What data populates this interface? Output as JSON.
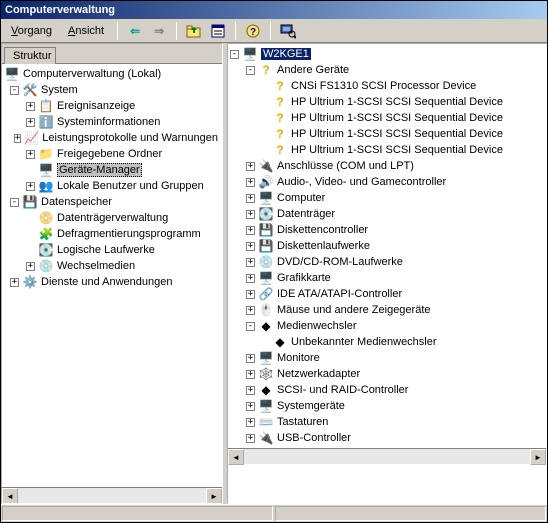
{
  "window": {
    "title": "Computerverwaltung"
  },
  "menu": {
    "vorgang": "Vorgang",
    "ansicht": "Ansicht"
  },
  "left": {
    "tab": "Struktur",
    "root": "Computerverwaltung (Lokal)",
    "system": "System",
    "ereignis": "Ereignisanzeige",
    "sysinfo": "Systeminformationen",
    "leistung": "Leistungsprotokolle und Warnungen",
    "freigeg": "Freigegebene Ordner",
    "geraete": "Geräte-Manager",
    "lokale": "Lokale Benutzer und Gruppen",
    "daten": "Datenspeicher",
    "dtverwalt": "Datenträgerverwaltung",
    "defrag": "Defragmentierungsprogramm",
    "logisch": "Logische Laufwerke",
    "wechsel": "Wechselmedien",
    "dienste": "Dienste und Anwendungen"
  },
  "right": {
    "root": "W2KGE1",
    "andere": "Andere Geräte",
    "dev0": "CNSi FS1310 SCSI Processor Device",
    "dev1": "HP Ultrium 1-SCSI SCSI Sequential Device",
    "dev2": "HP Ultrium 1-SCSI SCSI Sequential Device",
    "dev3": "HP Ultrium 1-SCSI SCSI Sequential Device",
    "dev4": "HP Ultrium 1-SCSI SCSI Sequential Device",
    "anschluesse": "Anschlüsse (COM und LPT)",
    "audio": "Audio-, Video- und Gamecontroller",
    "computer": "Computer",
    "datentraeger": "Datenträger",
    "diskctrl": "Diskettencontroller",
    "disklauf": "Diskettenlaufwerke",
    "dvd": "DVD/CD-ROM-Laufwerke",
    "grafik": "Grafikkarte",
    "ide": "IDE ATA/ATAPI-Controller",
    "maeuse": "Mäuse und andere Zeigegeräte",
    "medien": "Medienwechsler",
    "unbek": "Unbekannter Medienwechsler",
    "monitore": "Monitore",
    "netz": "Netzwerkadapter",
    "scsi": "SCSI- und RAID-Controller",
    "sysger": "Systemgeräte",
    "tast": "Tastaturen",
    "usb": "USB-Controller"
  }
}
